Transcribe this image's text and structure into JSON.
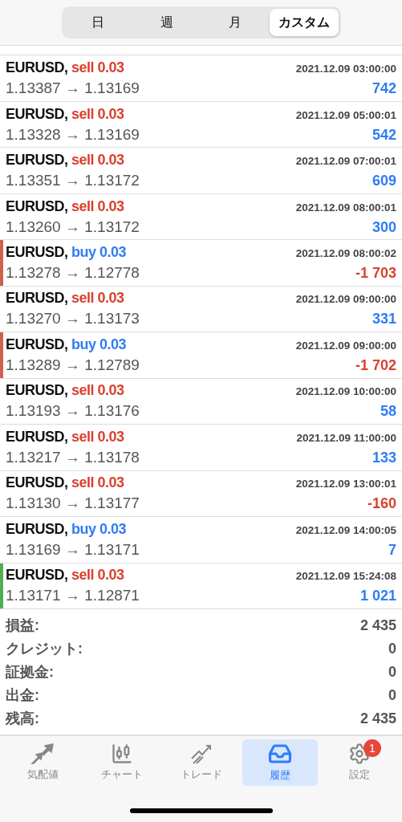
{
  "period_tabs": [
    {
      "label": "日",
      "selected": false
    },
    {
      "label": "週",
      "selected": false
    },
    {
      "label": "月",
      "selected": false
    },
    {
      "label": "カスタム",
      "selected": true
    }
  ],
  "deals": [
    {
      "symbol": "EURUSD,",
      "kind": "sell",
      "order": "sell 0.03",
      "time": "2021.12.09 03:00:00",
      "prices": "1.13387 → 1.13169",
      "profit": "742",
      "loss": false
    },
    {
      "symbol": "EURUSD,",
      "kind": "sell",
      "order": "sell 0.03",
      "time": "2021.12.09 05:00:01",
      "prices": "1.13328 → 1.13169",
      "profit": "542",
      "loss": false
    },
    {
      "symbol": "EURUSD,",
      "kind": "sell",
      "order": "sell 0.03",
      "time": "2021.12.09 07:00:01",
      "prices": "1.13351 → 1.13172",
      "profit": "609",
      "loss": false
    },
    {
      "symbol": "EURUSD,",
      "kind": "sell",
      "order": "sell 0.03",
      "time": "2021.12.09 08:00:01",
      "prices": "1.13260 → 1.13172",
      "profit": "300",
      "loss": false
    },
    {
      "symbol": "EURUSD,",
      "kind": "buy",
      "order": "buy 0.03",
      "time": "2021.12.09 08:00:02",
      "prices": "1.13278 → 1.12778",
      "profit": "-1 703",
      "loss": true,
      "color": "#d0604f"
    },
    {
      "symbol": "EURUSD,",
      "kind": "sell",
      "order": "sell 0.03",
      "time": "2021.12.09 09:00:00",
      "prices": "1.13270 → 1.13173",
      "profit": "331",
      "loss": false
    },
    {
      "symbol": "EURUSD,",
      "kind": "buy",
      "order": "buy 0.03",
      "time": "2021.12.09 09:00:00",
      "prices": "1.13289 → 1.12789",
      "profit": "-1 702",
      "loss": true,
      "color": "#d0604f"
    },
    {
      "symbol": "EURUSD,",
      "kind": "sell",
      "order": "sell 0.03",
      "time": "2021.12.09 10:00:00",
      "prices": "1.13193 → 1.13176",
      "profit": "58",
      "loss": false
    },
    {
      "symbol": "EURUSD,",
      "kind": "sell",
      "order": "sell 0.03",
      "time": "2021.12.09 11:00:00",
      "prices": "1.13217 → 1.13178",
      "profit": "133",
      "loss": false
    },
    {
      "symbol": "EURUSD,",
      "kind": "sell",
      "order": "sell 0.03",
      "time": "2021.12.09 13:00:01",
      "prices": "1.13130 → 1.13177",
      "profit": "-160",
      "loss": true
    },
    {
      "symbol": "EURUSD,",
      "kind": "buy",
      "order": "buy 0.03",
      "time": "2021.12.09 14:00:05",
      "prices": "1.13169 → 1.13171",
      "profit": "7",
      "loss": false
    },
    {
      "symbol": "EURUSD,",
      "kind": "sell",
      "order": "sell 0.03",
      "time": "2021.12.09 15:24:08",
      "prices": "1.13171 → 1.12871",
      "profit": "1 021",
      "loss": false,
      "color": "#4caf50"
    }
  ],
  "summary": [
    {
      "label": "損益:",
      "value": "2 435"
    },
    {
      "label": "クレジット:",
      "value": "0"
    },
    {
      "label": "証拠金:",
      "value": "0"
    },
    {
      "label": "出金:",
      "value": "0"
    },
    {
      "label": "残高:",
      "value": "2 435"
    }
  ],
  "tab_bar": [
    {
      "kind": "quotes",
      "label": "気配値",
      "selected": false
    },
    {
      "kind": "chart",
      "label": "チャート",
      "selected": false
    },
    {
      "kind": "trade",
      "label": "トレード",
      "selected": false
    },
    {
      "kind": "history",
      "label": "履歴",
      "selected": true
    },
    {
      "kind": "settings",
      "label": "設定",
      "selected": false,
      "badge": "1"
    }
  ]
}
